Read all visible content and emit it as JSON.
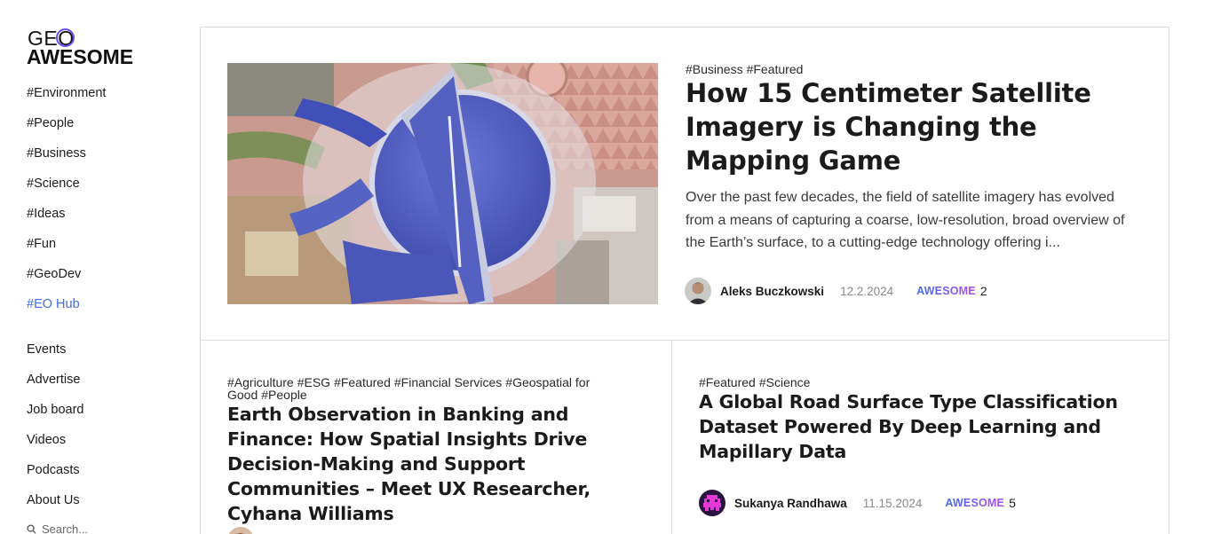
{
  "logo": {
    "line1": "GEO",
    "line2": "AWESOME"
  },
  "nav": {
    "categories": [
      "#Environment",
      "#People",
      "#Business",
      "#Science",
      "#Ideas",
      "#Fun",
      "#GeoDev",
      "#EO Hub"
    ],
    "pages": [
      "Events",
      "Advertise",
      "Job board",
      "Videos",
      "Podcasts",
      "About Us"
    ],
    "search_placeholder": "Search..."
  },
  "featured": {
    "tags": [
      "#Business",
      "#Featured"
    ],
    "title": "How 15 Centimeter Satellite Imagery is Changing the Mapping Game",
    "excerpt": "Over the past few decades, the field of satellite imagery has evolved from a means of capturing a coarse, low-resolution, broad overview of the Earth’s surface, to a cutting-edge technology offering i...",
    "author": "Aleks Buczkowski",
    "date": "12.2.2024",
    "badge": "AWESOME",
    "awesome_count": "2"
  },
  "card1": {
    "tags": [
      "#Agriculture",
      "#ESG",
      "#Featured",
      "#Financial Services",
      "#Geospatial for Good",
      "#People"
    ],
    "title": "Earth Observation in Banking and Finance: How Spatial Insights Drive Decision-Making and Support Communities – Meet UX Researcher, Cyhana Williams"
  },
  "card2": {
    "tags": [
      "#Featured",
      "#Science"
    ],
    "title": "A Global Road Surface Type Classification Dataset Powered By Deep Learning and Mapillary Data",
    "author": "Sukanya Randhawa",
    "date": "11.15.2024",
    "badge": "AWESOME",
    "awesome_count": "5"
  },
  "colors": {
    "accent": "#3d6bf2",
    "gradient_end": "#b34cf0",
    "border": "#dcdcdc"
  }
}
